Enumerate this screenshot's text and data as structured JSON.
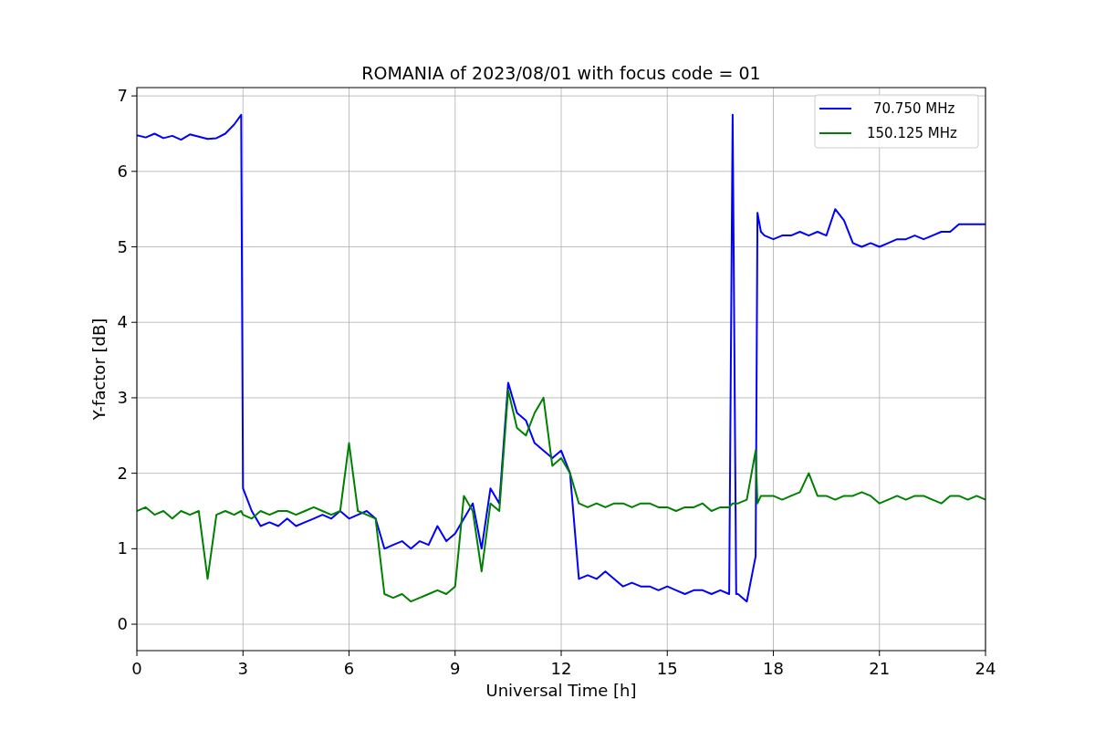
{
  "chart_data": {
    "type": "line",
    "grid": true,
    "legend": true,
    "title": "ROMANIA of 2023/08/01 with focus code = 01",
    "xlabel": "Universal Time [h]",
    "ylabel": "Y-factor [dB]",
    "xlim": [
      0,
      24
    ],
    "ylim": [
      -0.35,
      7.11
    ],
    "xticks": [
      0,
      3,
      6,
      9,
      12,
      15,
      18,
      21,
      24
    ],
    "yticks": [
      0,
      1,
      2,
      3,
      4,
      5,
      6,
      7
    ],
    "x": [
      0,
      0.25,
      0.5,
      0.75,
      1,
      1.25,
      1.5,
      1.75,
      2,
      2.25,
      2.5,
      2.75,
      2.95,
      3,
      3.25,
      3.5,
      3.75,
      4,
      4.25,
      4.5,
      4.75,
      5,
      5.25,
      5.5,
      5.75,
      6,
      6.25,
      6.5,
      6.75,
      7,
      7.25,
      7.5,
      7.75,
      8,
      8.25,
      8.5,
      8.75,
      9,
      9.25,
      9.5,
      9.75,
      10,
      10.25,
      10.5,
      10.75,
      11,
      11.25,
      11.5,
      11.75,
      12,
      12.25,
      12.5,
      12.75,
      13,
      13.25,
      13.5,
      13.75,
      14,
      14.25,
      14.5,
      14.75,
      15,
      15.25,
      15.5,
      15.75,
      16,
      16.25,
      16.5,
      16.75,
      16.85,
      16.95,
      17,
      17.25,
      17.5,
      17.55,
      17.65,
      17.75,
      18,
      18.25,
      18.5,
      18.75,
      19,
      19.25,
      19.5,
      19.75,
      20,
      20.25,
      20.5,
      20.75,
      21,
      21.25,
      21.5,
      21.75,
      22,
      22.25,
      22.5,
      22.75,
      23,
      23.25,
      23.5,
      23.75,
      24
    ],
    "series": [
      {
        "name": "70.750 MHz",
        "color": "#0000ff",
        "values": [
          6.48,
          6.45,
          6.5,
          6.44,
          6.47,
          6.42,
          6.49,
          6.46,
          6.43,
          6.44,
          6.5,
          6.62,
          6.75,
          1.8,
          1.5,
          1.3,
          1.35,
          1.3,
          1.4,
          1.3,
          1.35,
          1.4,
          1.45,
          1.4,
          1.5,
          1.4,
          1.45,
          1.5,
          1.4,
          1.0,
          1.05,
          1.1,
          1.0,
          1.1,
          1.05,
          1.3,
          1.1,
          1.2,
          1.4,
          1.6,
          1.0,
          1.8,
          1.6,
          3.2,
          2.8,
          2.7,
          2.4,
          2.3,
          2.2,
          2.3,
          2.0,
          0.6,
          0.65,
          0.6,
          0.7,
          0.6,
          0.5,
          0.55,
          0.5,
          0.5,
          0.45,
          0.5,
          0.45,
          0.4,
          0.45,
          0.45,
          0.4,
          0.45,
          0.4,
          6.75,
          0.4,
          0.4,
          0.3,
          0.9,
          5.45,
          5.2,
          5.15,
          5.1,
          5.15,
          5.15,
          5.2,
          5.15,
          5.2,
          5.15,
          5.5,
          5.35,
          5.05,
          5.0,
          5.05,
          5.0,
          5.05,
          5.1,
          5.1,
          5.15,
          5.1,
          5.15,
          5.2,
          5.2,
          5.3,
          5.3,
          5.3,
          5.3
        ]
      },
      {
        "name": "150.125 MHz",
        "color": "#008000",
        "values": [
          1.5,
          1.55,
          1.45,
          1.5,
          1.4,
          1.5,
          1.45,
          1.5,
          0.6,
          1.45,
          1.5,
          1.45,
          1.5,
          1.45,
          1.4,
          1.5,
          1.45,
          1.5,
          1.5,
          1.45,
          1.5,
          1.55,
          1.5,
          1.45,
          1.5,
          2.4,
          1.5,
          1.45,
          1.4,
          0.4,
          0.35,
          0.4,
          0.3,
          0.35,
          0.4,
          0.45,
          0.4,
          0.5,
          1.7,
          1.5,
          0.7,
          1.6,
          1.5,
          3.1,
          2.6,
          2.5,
          2.8,
          3.0,
          2.1,
          2.2,
          2.0,
          1.6,
          1.55,
          1.6,
          1.55,
          1.6,
          1.6,
          1.55,
          1.6,
          1.6,
          1.55,
          1.55,
          1.5,
          1.55,
          1.55,
          1.6,
          1.5,
          1.55,
          1.55,
          1.6,
          1.6,
          1.6,
          1.65,
          2.3,
          1.6,
          1.7,
          1.7,
          1.7,
          1.65,
          1.7,
          1.75,
          2.0,
          1.7,
          1.7,
          1.65,
          1.7,
          1.7,
          1.75,
          1.7,
          1.6,
          1.65,
          1.7,
          1.65,
          1.7,
          1.7,
          1.65,
          1.6,
          1.7,
          1.7,
          1.65,
          1.7,
          1.65
        ]
      }
    ]
  }
}
